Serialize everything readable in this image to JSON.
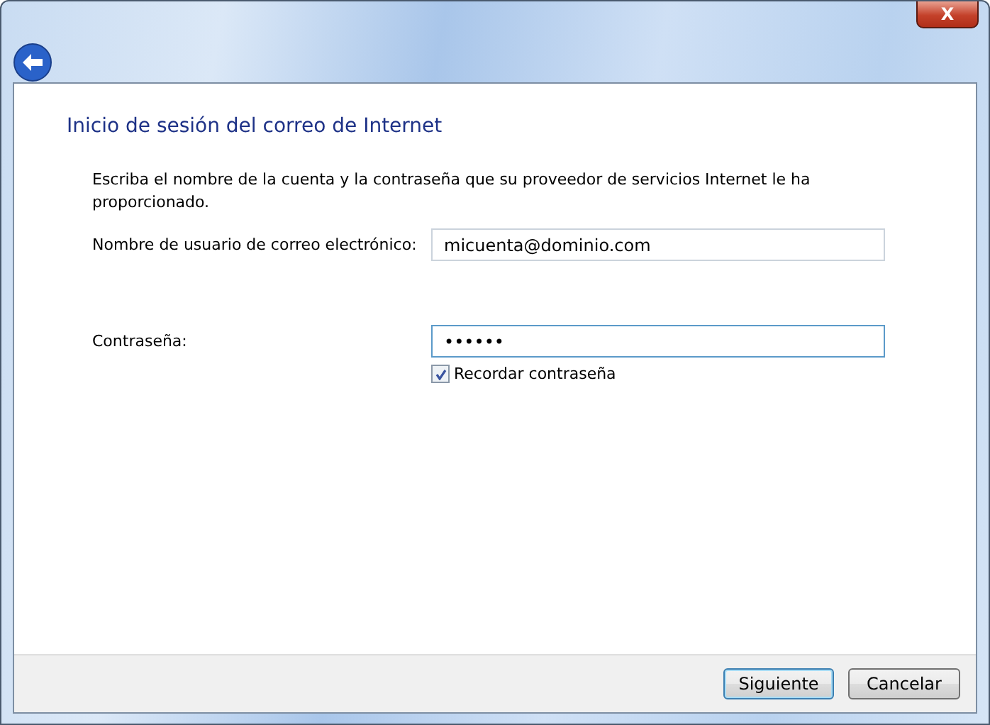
{
  "window": {
    "close_label": "X"
  },
  "heading": "Inicio de sesión del correo de Internet",
  "intro": "Escriba el nombre de la cuenta y la contraseña que su proveedor de servicios Internet le ha proporcionado.",
  "fields": [
    {
      "label": "Nombre de usuario de correo electrónico:",
      "value": "micuenta@dominio.com",
      "focused": false
    },
    {
      "label": "Contraseña:",
      "value": "••••••",
      "focused": true
    }
  ],
  "remember": {
    "label": "Recordar contraseña",
    "checked": true
  },
  "buttons": [
    {
      "label": "Siguiente",
      "default": true
    },
    {
      "label": "Cancelar",
      "default": false
    }
  ]
}
